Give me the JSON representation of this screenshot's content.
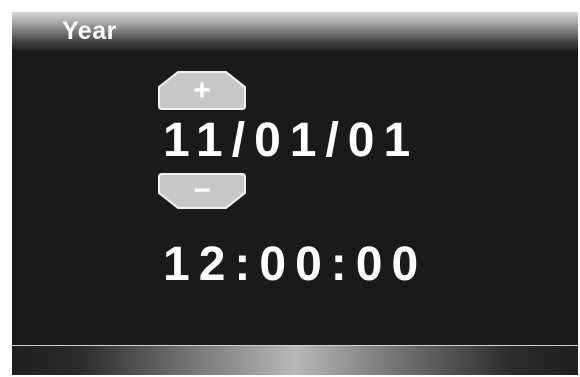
{
  "header": {
    "title": "Year"
  },
  "controls": {
    "increment_label": "+",
    "decrement_label": "−"
  },
  "display": {
    "date": "11/01/01",
    "time": "12:00:00"
  },
  "colors": {
    "background": "#1a1a1a",
    "button_fill": "#c8c8c8",
    "text": "#ffffff"
  }
}
